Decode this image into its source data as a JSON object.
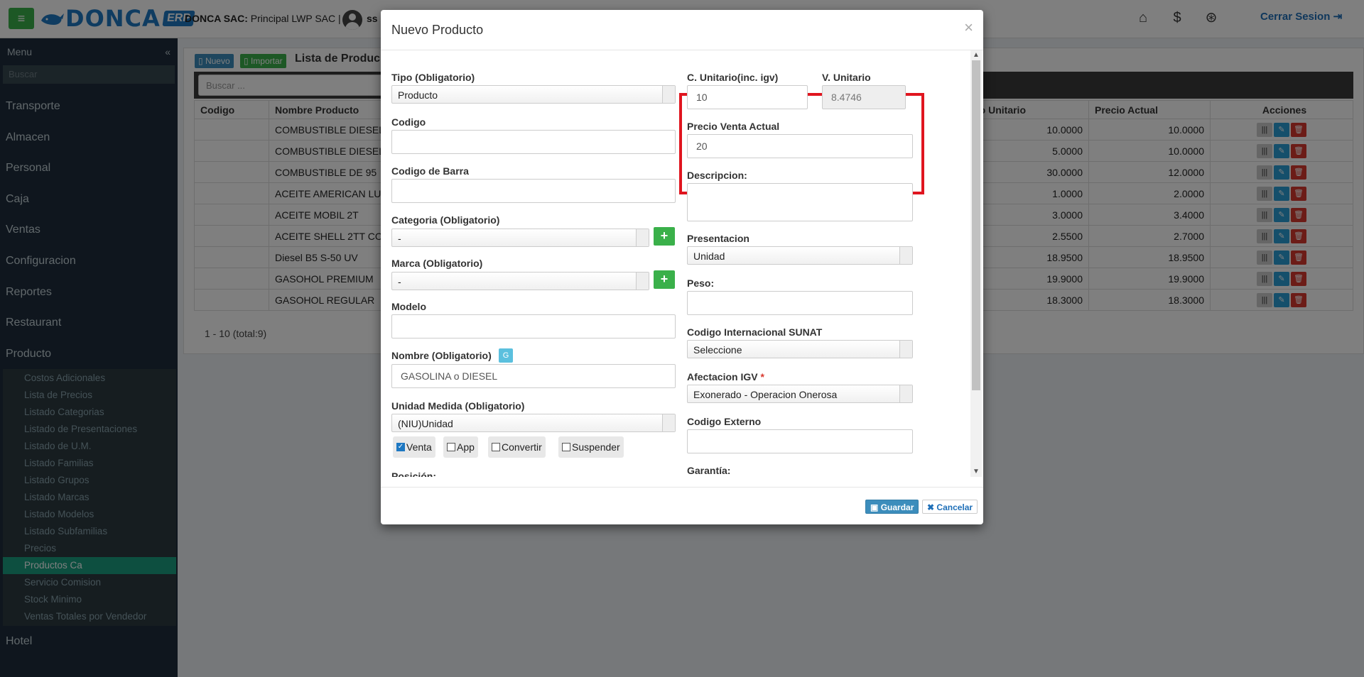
{
  "header": {
    "brand": "DONCA",
    "brand_suffix": "ERP",
    "company_bold": "DONCA SAC:",
    "company_rest": " Principal LWP SAC |",
    "user": "ss",
    "logout": "Cerrar Sesion",
    "icons": [
      "home-icon",
      "dollar-icon",
      "lock-icon"
    ]
  },
  "sidebar": {
    "title": "Menu",
    "search_placeholder": "Buscar",
    "items": [
      "Transporte",
      "Almacen",
      "Personal",
      "Caja",
      "Ventas",
      "Configuracion",
      "Reportes",
      "Restaurant",
      "Producto"
    ],
    "producto_sub": [
      "Costos Adicionales",
      "Lista de Precios",
      "Listado Categorias",
      "Listado de Presentaciones",
      "Listado de U.M.",
      "Listado Familias",
      "Listado Grupos",
      "Listado Marcas",
      "Listado Modelos",
      "Listado Subfamilias",
      "Precios",
      "Productos Ca",
      "Servicio Comision",
      "Stock Minimo",
      "Ventas Totales por Vendedor"
    ],
    "active_sub": "Productos Ca",
    "after": "Hotel"
  },
  "list": {
    "btn_nuevo": "Nuevo",
    "btn_importar": "Importar",
    "title": "Lista de Produc",
    "search_placeholder": "Buscar ...",
    "columns": [
      "Codigo",
      "Nombre Producto",
      "to Unitario",
      "Precio Actual",
      "Acciones"
    ],
    "rows": [
      {
        "codigo": "",
        "nombre": "COMBUSTIBLE DIESEL",
        "costo": "10.0000",
        "precio": "10.0000"
      },
      {
        "codigo": "",
        "nombre": "COMBUSTIBLE DIESEL",
        "costo": "5.0000",
        "precio": "10.0000"
      },
      {
        "codigo": "",
        "nombre": "COMBUSTIBLE DE 95",
        "costo": "30.0000",
        "precio": "12.0000"
      },
      {
        "codigo": "",
        "nombre": "ACEITE AMERICAN LUI",
        "costo": "1.0000",
        "precio": "2.0000"
      },
      {
        "codigo": "",
        "nombre": "ACEITE MOBIL 2T",
        "costo": "3.0000",
        "precio": "3.4000"
      },
      {
        "codigo": "",
        "nombre": "ACEITE SHELL 2TT CO",
        "costo": "2.5500",
        "precio": "2.7000"
      },
      {
        "codigo": "",
        "nombre": "Diesel B5 S-50 UV",
        "costo": "18.9500",
        "precio": "18.9500"
      },
      {
        "codigo": "",
        "nombre": "GASOHOL PREMIUM",
        "costo": "19.9000",
        "precio": "19.9000"
      },
      {
        "codigo": "",
        "nombre": "GASOHOL REGULAR",
        "costo": "18.3000",
        "precio": "18.3000"
      }
    ],
    "pager": "1 - 10 (total:9)"
  },
  "modal": {
    "title": "Nuevo Producto",
    "close": "×",
    "tipo_label": "Tipo (Obligatorio)",
    "tipo_value": "Producto",
    "codigo_label": "Codigo",
    "codigo_value": "",
    "barra_label": "Codigo de Barra",
    "barra_value": "",
    "categoria_label": "Categoria (Obligatorio)",
    "categoria_value": "-",
    "marca_label": "Marca (Obligatorio)",
    "marca_value": "-",
    "modelo_label": "Modelo",
    "modelo_value": "",
    "nombre_label": "Nombre (Obligatorio)",
    "nombre_badge": "G",
    "nombre_value": "GASOLINA o DIESEL",
    "unidad_label": "Unidad Medida (Obligatorio)",
    "unidad_value": "(NIU)Unidad",
    "checks": [
      {
        "label": "Venta",
        "checked": true
      },
      {
        "label": "App",
        "checked": false
      },
      {
        "label": "Convertir",
        "checked": false
      },
      {
        "label": "Suspender",
        "checked": false
      }
    ],
    "posicion_label": "Posición:",
    "cunit_label": "C. Unitario(inc. igv)",
    "cunit_value": "10",
    "vunit_label": "V. Unitario",
    "vunit_value": "8.4746",
    "pventa_label": "Precio Venta Actual",
    "pventa_value": "20",
    "descripcion_label": "Descripcion:",
    "presentacion_label": "Presentacion",
    "presentacion_value": "Unidad",
    "peso_label": "Peso:",
    "peso_value": "",
    "sunat_label": "Codigo Internacional SUNAT",
    "sunat_value": "Seleccione",
    "igv_label": "Afectacion IGV",
    "igv_required": "*",
    "igv_value": "Exonerado - Operacion Onerosa",
    "externo_label": "Codigo Externo",
    "externo_value": "",
    "garantia_label": "Garantía:",
    "guardar": "Guardar",
    "cancelar": "Cancelar",
    "highlight_color": "#e0151f"
  }
}
